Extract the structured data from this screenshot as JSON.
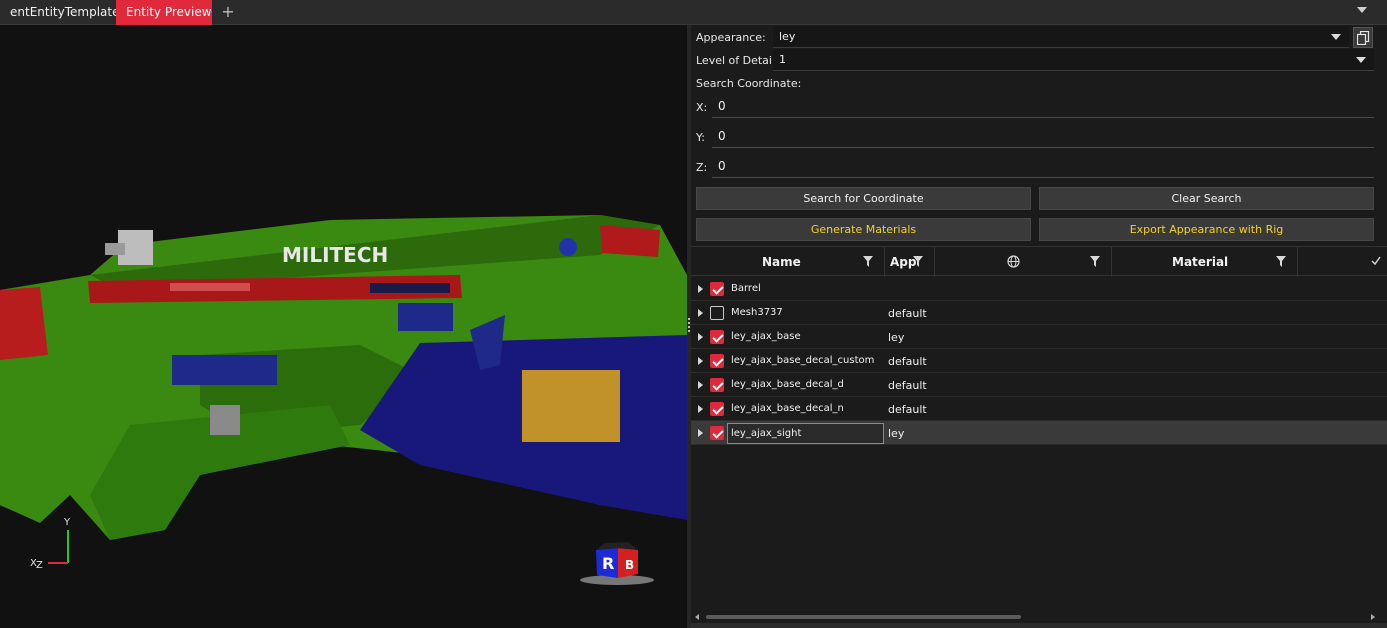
{
  "tabs": [
    {
      "label": "entEntityTemplate",
      "active": false
    },
    {
      "label": "Entity Preview",
      "active": true
    }
  ],
  "tab_add_label": "+",
  "viewport": {
    "brand_text": "MILITECH",
    "cube_labels": [
      "R",
      "B"
    ],
    "axis_labels": {
      "y": "Y",
      "x": "X",
      "z": "Z"
    }
  },
  "properties": {
    "appearance_label": "Appearance:",
    "appearance_value": "ley",
    "lod_label": "Level of Detail:",
    "lod_value": "1",
    "search_label": "Search Coordinate:",
    "x_label": "X:",
    "x_value": "0",
    "y_label": "Y:",
    "y_value": "0",
    "z_label": "Z:",
    "z_value": "0"
  },
  "buttons": {
    "search_coord": "Search for Coordinate",
    "clear_search": "Clear Search",
    "generate_materials": "Generate Materials",
    "export_appearance": "Export Appearance with Rig"
  },
  "grid": {
    "columns": {
      "name": "Name",
      "app": "App",
      "material": "Material"
    },
    "rows": [
      {
        "name": "Barrel",
        "app": "",
        "checked": true,
        "selected": false
      },
      {
        "name": "Mesh3737",
        "app": "default",
        "checked": false,
        "selected": false
      },
      {
        "name": "ley_ajax_base",
        "app": "ley",
        "checked": true,
        "selected": false
      },
      {
        "name": "ley_ajax_base_decal_custom",
        "app": "default",
        "checked": true,
        "selected": false
      },
      {
        "name": "ley_ajax_base_decal_d",
        "app": "default",
        "checked": true,
        "selected": false
      },
      {
        "name": "ley_ajax_base_decal_n",
        "app": "default",
        "checked": true,
        "selected": false
      },
      {
        "name": "ley_ajax_sight",
        "app": "ley",
        "checked": true,
        "selected": true
      }
    ]
  },
  "colors": {
    "accent": "#e0293b",
    "button_text_highlight": "#f2d22a",
    "body_green": "#3a8a12",
    "mag_blue": "#18187a"
  }
}
